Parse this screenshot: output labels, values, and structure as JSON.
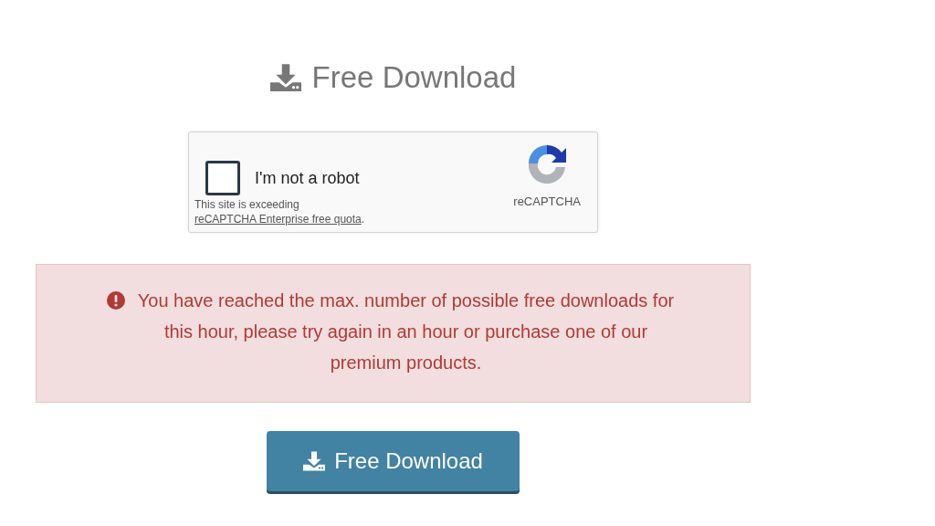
{
  "heading": {
    "text": "Free Download"
  },
  "captcha": {
    "label": "I'm not a robot",
    "checked": false,
    "brand": "reCAPTCHA",
    "notice_prefix": "This site is exceeding ",
    "notice_link": "reCAPTCHA Enterprise free quota",
    "notice_suffix": "."
  },
  "alert": {
    "message": "You have reached the max. number of possible free downloads for this hour, please try again in an hour or purchase one of our premium products."
  },
  "button": {
    "label": "Free Download"
  }
}
